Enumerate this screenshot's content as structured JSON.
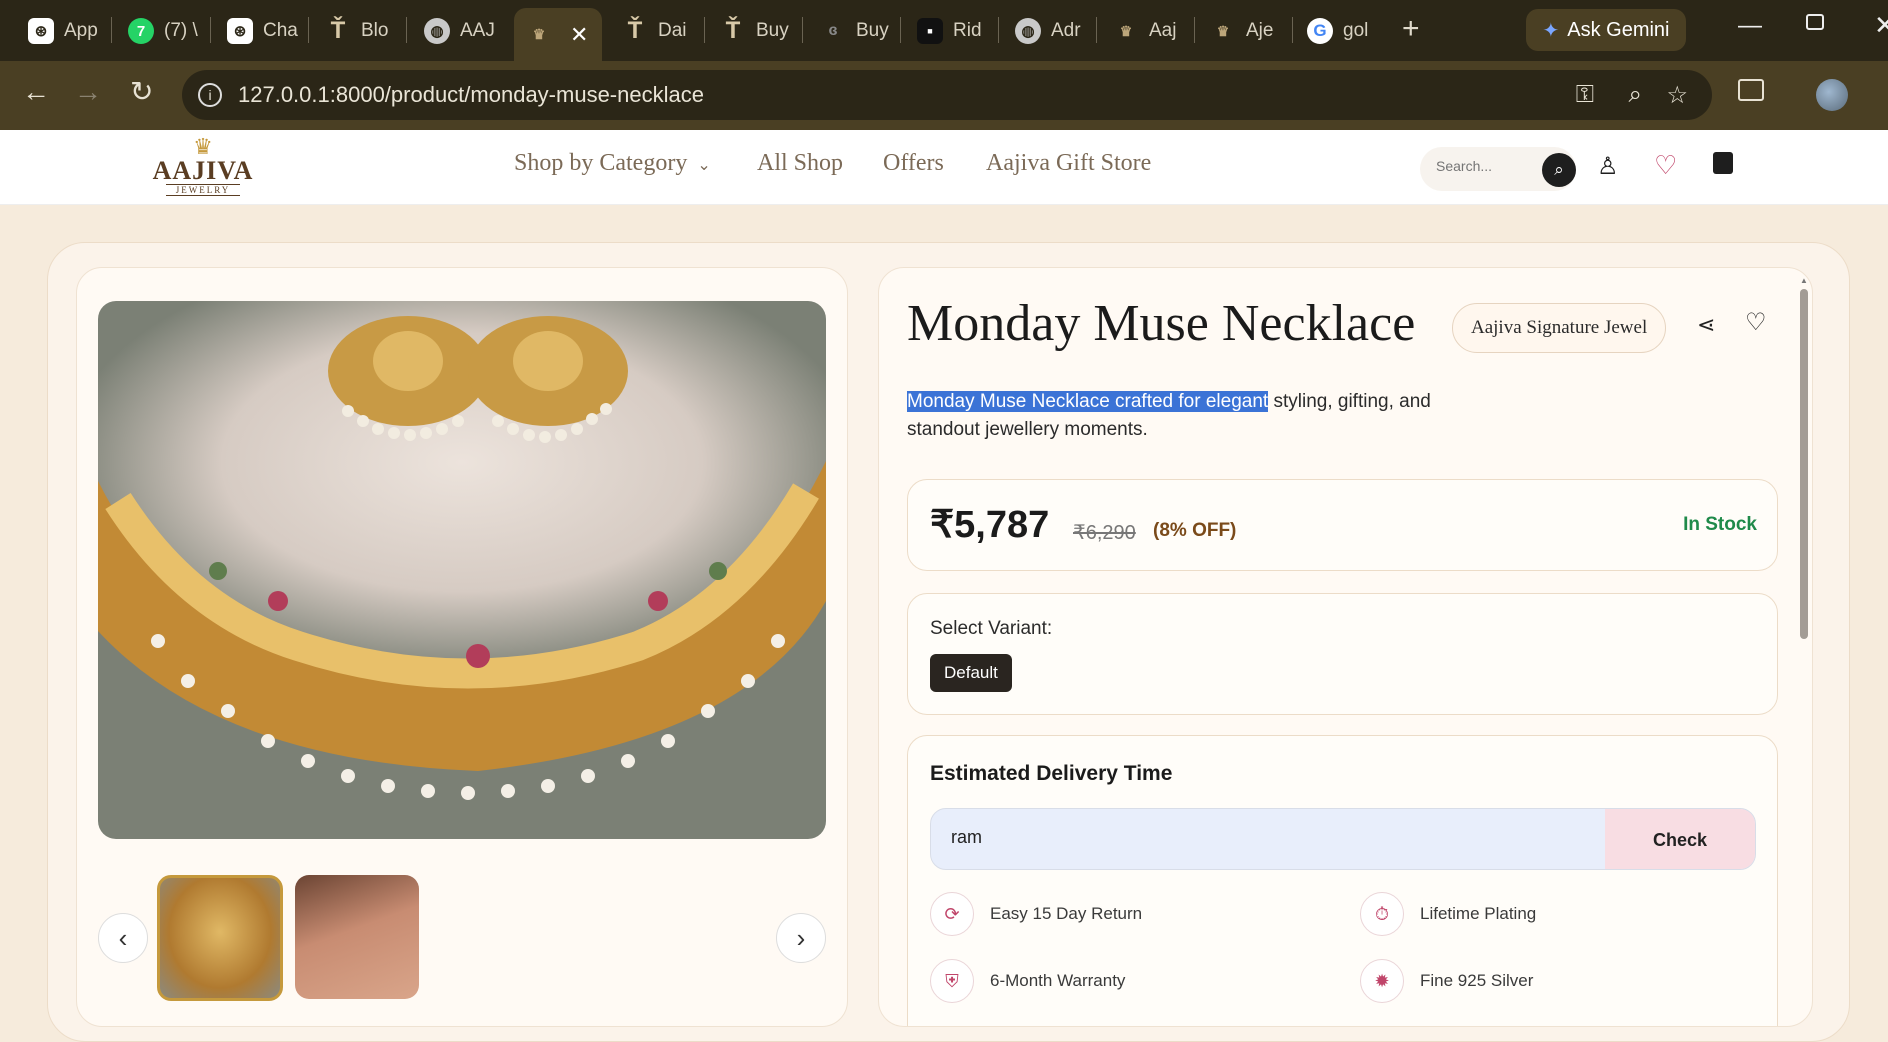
{
  "browser": {
    "tabs": [
      {
        "label": "App",
        "icon": "openai-icon"
      },
      {
        "label": "(7) \\",
        "icon": "whatsapp-icon"
      },
      {
        "label": "Cha",
        "icon": "openai-icon"
      },
      {
        "label": "Blo",
        "icon": "tanishq-icon"
      },
      {
        "label": "AAJ",
        "icon": "globe-icon"
      },
      {
        "label": "",
        "icon": "aajiva-icon"
      },
      {
        "label": "Dai",
        "icon": "tanishq-icon"
      },
      {
        "label": "Buy",
        "icon": "tanishq-icon"
      },
      {
        "label": "Buy",
        "icon": "caratlane-icon"
      },
      {
        "label": "Rid",
        "icon": "brand-icon"
      },
      {
        "label": "Adr",
        "icon": "globe-icon"
      },
      {
        "label": "Aaj",
        "icon": "aajiva-icon"
      },
      {
        "label": "Aje",
        "icon": "aajiva-icon"
      },
      {
        "label": "gol",
        "icon": "google-icon"
      }
    ],
    "gemini_label": "Ask Gemini",
    "url": "127.0.0.1:8000/product/monday-muse-necklace"
  },
  "site": {
    "logo_text": "AAJIVA",
    "logo_sub": "JEWELRY",
    "nav": [
      "Shop by Category",
      "All Shop",
      "Offers",
      "Aajiva Gift Store"
    ],
    "search_placeholder": "Search..."
  },
  "product": {
    "title": "Monday Muse Necklace",
    "collection_badge": "Aajiva Signature Jewel",
    "desc_highlight": "Monday Muse Necklace crafted for elegant",
    "desc_rest": " styling, gifting, and standout jewellery moments.",
    "price": "₹5,787",
    "mrp": "₹6,290",
    "discount": "(8% OFF)",
    "stock": "In Stock",
    "variant_label": "Select Variant:",
    "variant_selected": "Default",
    "delivery_title": "Estimated Delivery Time",
    "pincode_value": "ram",
    "check_label": "Check",
    "features": [
      "Easy 15 Day Return",
      "Lifetime Plating",
      "6-Month Warranty",
      "Fine 925 Silver"
    ]
  },
  "colors": {
    "accent": "#c0456a",
    "stock": "#1f8a4a",
    "highlight": "#3b73d6",
    "dark": "#2b2617"
  }
}
